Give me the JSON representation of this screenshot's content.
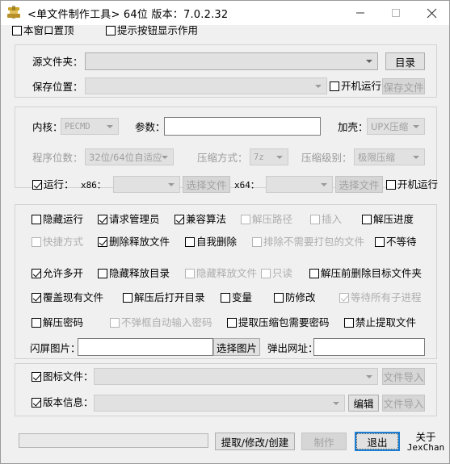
{
  "window": {
    "title": "<单文件制作工具> 64位 版本：7.0.2.32",
    "icon": "app-icon",
    "minimize": "minimize-icon",
    "maximize": "maximize-icon",
    "close": "close-icon"
  },
  "topbar": {
    "always_on_top": {
      "label": "本窗口置顶",
      "checked": false,
      "enabled": true
    },
    "show_tip_buttons": {
      "label": "提示按钮显示作用",
      "checked": false,
      "enabled": true
    }
  },
  "source": {
    "source_folder_label": "源文件夹：",
    "source_folder_value": "",
    "browse_button": "目录",
    "save_location_label": "保存位置：",
    "save_location_value": "",
    "boot_run": {
      "label": "开机运行",
      "checked": false,
      "enabled": true
    },
    "save_file_button": "保存文件"
  },
  "core": {
    "kernel_label": "内核：",
    "kernel_value": "PECMD",
    "params_label": "参数：",
    "params_value": "",
    "packer_label": "加壳：",
    "packer_value": "UPX压缩",
    "bitness_label": "程序位数：",
    "bitness_value": "32位/64位自适应",
    "compress_method_label": "压缩方式：",
    "compress_method_value": "7z",
    "compress_level_label": "压缩级别：",
    "compress_level_value": "极限压缩",
    "run": {
      "label": "运行：",
      "checked": true,
      "enabled": true
    },
    "x86_label": "x86：",
    "x86_value": "",
    "x86_choose_button": "选择文件",
    "x64_label": "x64：",
    "x64_value": "",
    "x64_choose_button": "选择文件",
    "boot_run": {
      "label": "开机运行",
      "checked": false,
      "enabled": true
    }
  },
  "options": {
    "rows": [
      [
        {
          "label": "隐藏运行",
          "checked": false,
          "enabled": true
        },
        {
          "label": "请求管理员",
          "checked": true,
          "enabled": true
        },
        {
          "label": "兼容算法",
          "checked": true,
          "enabled": true
        },
        {
          "label": "解压路径",
          "checked": false,
          "enabled": false
        },
        {
          "label": "插入",
          "checked": false,
          "enabled": false
        },
        {
          "label": "解压进度",
          "checked": false,
          "enabled": true
        }
      ],
      [
        {
          "label": "快捷方式",
          "checked": false,
          "enabled": false
        },
        {
          "label": "删除释放文件",
          "checked": true,
          "enabled": true
        },
        {
          "label": "自我删除",
          "checked": false,
          "enabled": true
        },
        {
          "label": "排除不需要打包的文件",
          "checked": false,
          "enabled": false
        },
        {
          "label": "不等待",
          "checked": false,
          "enabled": true
        }
      ],
      [
        {
          "label": "允许多开",
          "checked": true,
          "enabled": true
        },
        {
          "label": "隐藏释放目录",
          "checked": false,
          "enabled": true
        },
        {
          "label": "隐藏释放文件",
          "checked": false,
          "enabled": false
        },
        {
          "label": "只读",
          "checked": false,
          "enabled": false
        },
        {
          "label": "解压前删除目标文件夹",
          "checked": false,
          "enabled": true
        }
      ],
      [
        {
          "label": "覆盖现有文件",
          "checked": true,
          "enabled": true
        },
        {
          "label": "解压后打开目录",
          "checked": false,
          "enabled": true
        },
        {
          "label": "变量",
          "checked": false,
          "enabled": true
        },
        {
          "label": "防修改",
          "checked": false,
          "enabled": true
        },
        {
          "label": "等待所有子进程",
          "checked": true,
          "enabled": false
        }
      ],
      [
        {
          "label": "解压密码",
          "checked": false,
          "enabled": true
        },
        {
          "label": "不弹框自动输入密码",
          "checked": false,
          "enabled": false
        },
        {
          "label": "提取压缩包需要密码",
          "checked": false,
          "enabled": true
        },
        {
          "label": "禁止提取文件",
          "checked": false,
          "enabled": true
        }
      ]
    ],
    "splash_label": "闪屏图片：",
    "splash_value": "",
    "splash_button": "选择图片",
    "popup_url_label": "弹出网址：",
    "popup_url_value": ""
  },
  "resources": {
    "icon_file": {
      "label": "图标文件：",
      "checked": true,
      "value": "",
      "import_button": "文件导入"
    },
    "version_info": {
      "label": "版本信息：",
      "checked": true,
      "value": "",
      "edit_button": "编辑",
      "import_button": "文件导入"
    }
  },
  "footer": {
    "status_text": "",
    "extract_modify_create_button": "提取/修改/创建",
    "make_button": "制作",
    "exit_button": "退出",
    "about_line1": "关于",
    "about_line2": "JexChan"
  }
}
